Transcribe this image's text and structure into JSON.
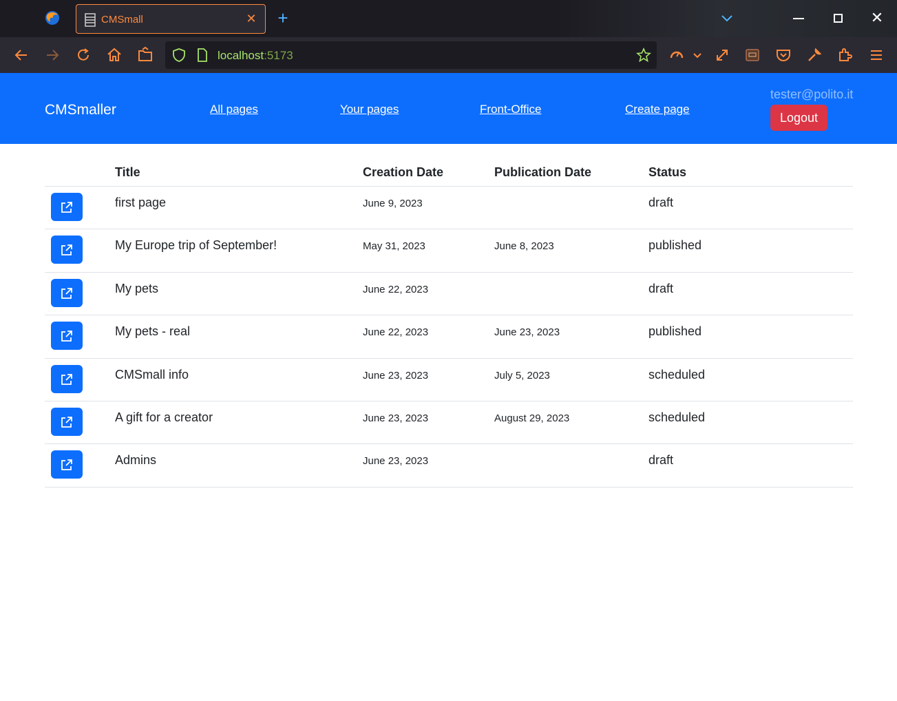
{
  "browser": {
    "tab_title": "CMSmall",
    "tab_close": "✕",
    "new_tab": "+",
    "url_host": "localhost",
    "url_port": ":5173",
    "window_close": "✕"
  },
  "header": {
    "brand": "CMSmaller",
    "nav": [
      "All pages",
      "Your pages",
      "Front-Office",
      "Create page"
    ],
    "user_email": "tester@polito.it",
    "logout_label": "Logout"
  },
  "table": {
    "columns": [
      "Title",
      "Creation Date",
      "Publication Date",
      "Status"
    ],
    "rows": [
      {
        "title": "first page",
        "creation_date": "June 9, 2023",
        "publication_date": "",
        "status": "draft",
        "editable": false
      },
      {
        "title": "My Europe trip of September!",
        "creation_date": "May 31, 2023",
        "publication_date": "June 8, 2023",
        "status": "published",
        "editable": false
      },
      {
        "title": "My pets",
        "creation_date": "June 22, 2023",
        "publication_date": "",
        "status": "draft",
        "editable": true
      },
      {
        "title": "My pets - real",
        "creation_date": "June 22, 2023",
        "publication_date": "June 23, 2023",
        "status": "published",
        "editable": true
      },
      {
        "title": "CMSmall info",
        "creation_date": "June 23, 2023",
        "publication_date": "July 5, 2023",
        "status": "scheduled",
        "editable": false
      },
      {
        "title": "A gift for a creator",
        "creation_date": "June 23, 2023",
        "publication_date": "August 29, 2023",
        "status": "scheduled",
        "editable": false
      },
      {
        "title": "Admins",
        "creation_date": "June 23, 2023",
        "publication_date": "",
        "status": "draft",
        "editable": false
      }
    ]
  },
  "colors": {
    "primary": "#0d6efd",
    "danger": "#dc3545",
    "warning": "#ffc107",
    "browser_accent": "#ff8a3d"
  },
  "icons": {
    "open": "external-link-icon",
    "edit": "pencil-square-icon",
    "delete": "trash-icon"
  }
}
